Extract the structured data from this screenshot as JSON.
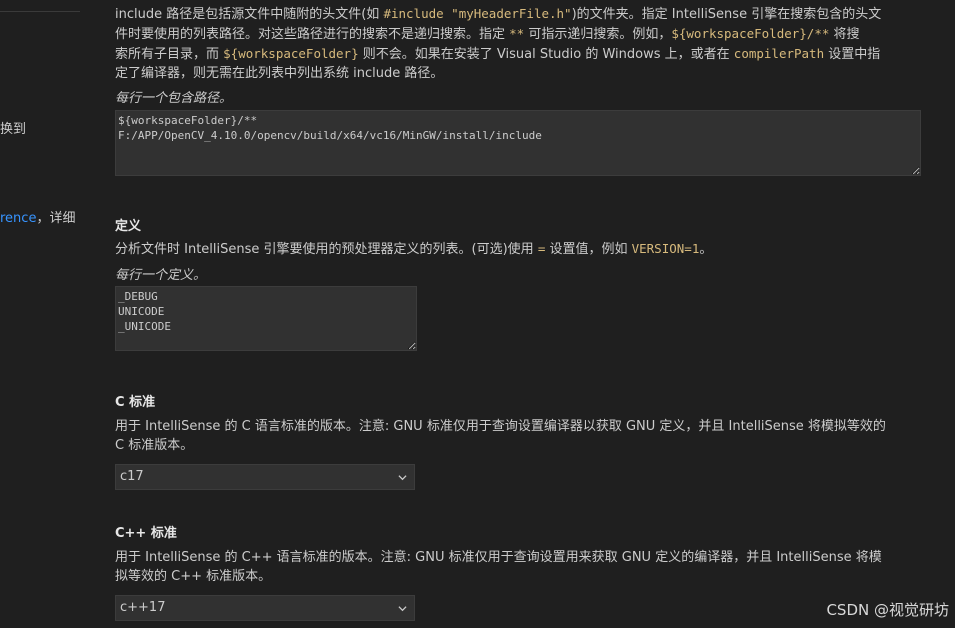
{
  "left_pane": {
    "fragment_1": "换到",
    "fragment_2_link": "rence",
    "fragment_2_text": "，详细"
  },
  "include_path": {
    "desc_line1_a": "include 路径是包括源文件中随附的头文件(如 ",
    "desc_line1_code": "#include \"myHeaderFile.h\"",
    "desc_line1_b": ")的文件夹。指定 IntelliSense 引擎在搜索包含的头文",
    "desc_line2_a": "件时要使用的列表路径。对这些路径进行的搜索不是递归搜索。指定 ",
    "desc_line2_code1": "**",
    "desc_line2_b": " 可指示递归搜索。例如，",
    "desc_line2_code2": "${workspaceFolder}/**",
    "desc_line2_c": " 将搜",
    "desc_line3_a": "索所有子目录，而 ",
    "desc_line3_code1": "${workspaceFolder}",
    "desc_line3_b": " 则不会。如果在安装了 Visual Studio 的 Windows 上，或者在 ",
    "desc_line3_code2": "compilerPath",
    "desc_line3_c": " 设置中指",
    "desc_line4": "定了编译器，则无需在此列表中列出系统 include 路径。",
    "hint": "每行一个包含路径。",
    "value": "${workspaceFolder}/**\nF:/APP/OpenCV_4.10.0/opencv/build/x64/vc16/MinGW/install/include"
  },
  "defines": {
    "title": "定义",
    "desc_a": "分析文件时 IntelliSense 引擎要使用的预处理器定义的列表。(可选)使用 ",
    "desc_code1": "=",
    "desc_b": " 设置值，例如 ",
    "desc_code2": "VERSION=1",
    "desc_c": "。",
    "hint": "每行一个定义。",
    "value": "_DEBUG\nUNICODE\n_UNICODE"
  },
  "c_standard": {
    "title": "C 标准",
    "desc_line1": "用于 IntelliSense 的 C 语言标准的版本。注意: GNU 标准仅用于查询设置编译器以获取 GNU 定义，并且 IntelliSense 将模拟等效的",
    "desc_line2": "C 标准版本。",
    "selected": "c17"
  },
  "cpp_standard": {
    "title": "C++ 标准",
    "desc_line1": "用于 IntelliSense 的 C++ 语言标准的版本。注意: GNU 标准仅用于查询设置用来获取 GNU 定义的编译器，并且 IntelliSense 将模",
    "desc_line2": "拟等效的 C++ 标准版本。",
    "selected": "c++17"
  },
  "watermark": "CSDN @视觉研坊",
  "icons": {
    "dropdown": "chevron-down-icon"
  }
}
